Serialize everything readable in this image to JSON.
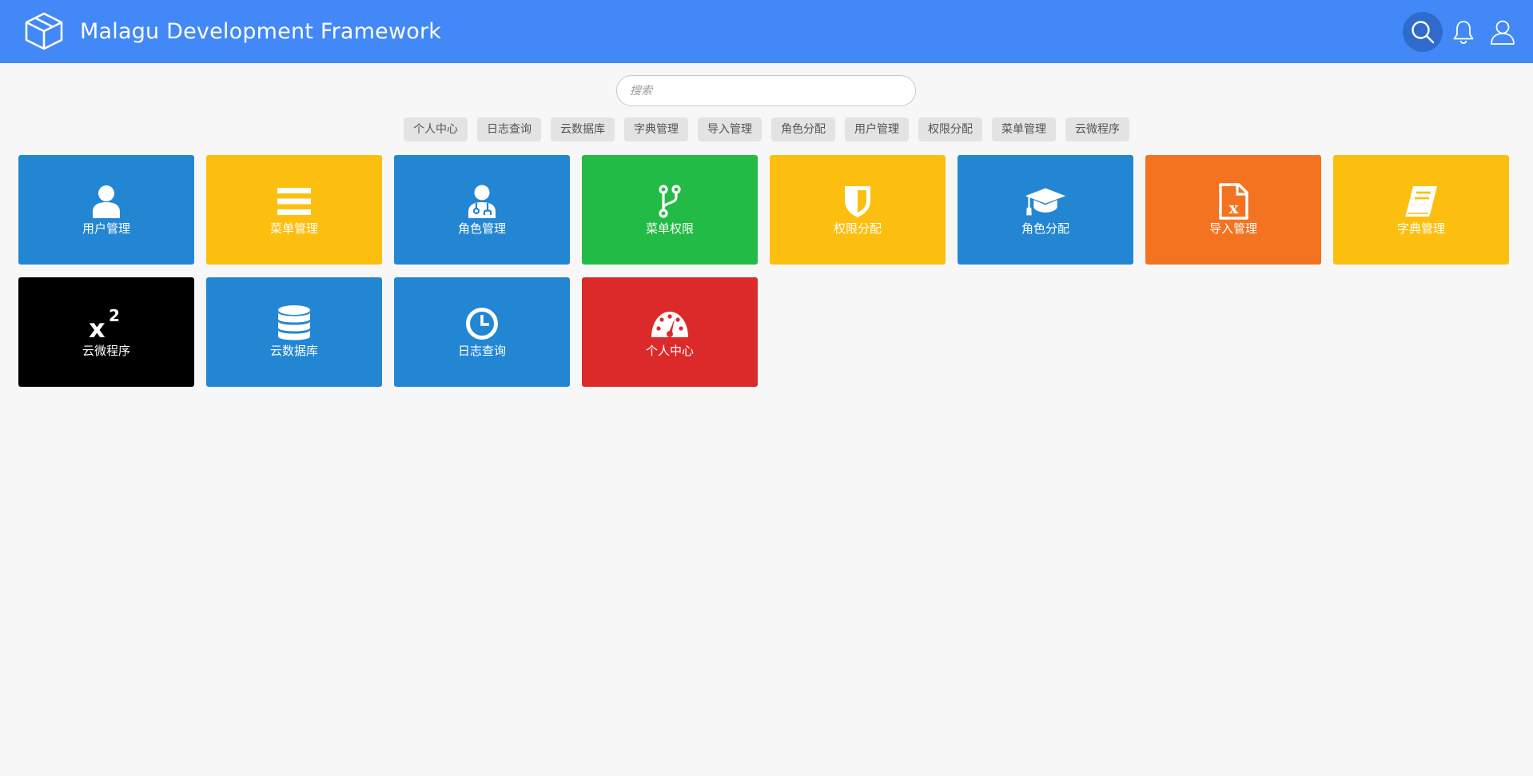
{
  "header": {
    "title": "Malagu Development Framework",
    "logo_icon": "cube-icon",
    "background_color": "#4388f7",
    "actions": [
      {
        "name": "search-icon"
      },
      {
        "name": "bell-icon"
      },
      {
        "name": "user-icon"
      }
    ]
  },
  "search": {
    "placeholder": "搜索",
    "value": ""
  },
  "quick_tags": [
    "个人中心",
    "日志查询",
    "云数据库",
    "字典管理",
    "导入管理",
    "角色分配",
    "用户管理",
    "权限分配",
    "菜单管理",
    "云微程序"
  ],
  "tiles": [
    {
      "label": "用户管理",
      "icon": "user-icon",
      "color": "#2386d3"
    },
    {
      "label": "菜单管理",
      "icon": "menu-bars-icon",
      "color": "#fdbf0f"
    },
    {
      "label": "角色管理",
      "icon": "user-doctor-icon",
      "color": "#2386d3"
    },
    {
      "label": "菜单权限",
      "icon": "code-branch-icon",
      "color": "#22bb45"
    },
    {
      "label": "权限分配",
      "icon": "shield-icon",
      "color": "#fdbf0f"
    },
    {
      "label": "角色分配",
      "icon": "graduation-cap-icon",
      "color": "#2386d3"
    },
    {
      "label": "导入管理",
      "icon": "excel-file-icon",
      "color": "#f37321"
    },
    {
      "label": "字典管理",
      "icon": "book-icon",
      "color": "#fdbf0f"
    },
    {
      "label": "云微程序",
      "icon": "superscript-icon",
      "color": "#000000"
    },
    {
      "label": "云数据库",
      "icon": "database-icon",
      "color": "#2386d3"
    },
    {
      "label": "日志查询",
      "icon": "clock-icon",
      "color": "#2386d3"
    },
    {
      "label": "个人中心",
      "icon": "dashboard-gauge-icon",
      "color": "#dc2a2a"
    }
  ]
}
